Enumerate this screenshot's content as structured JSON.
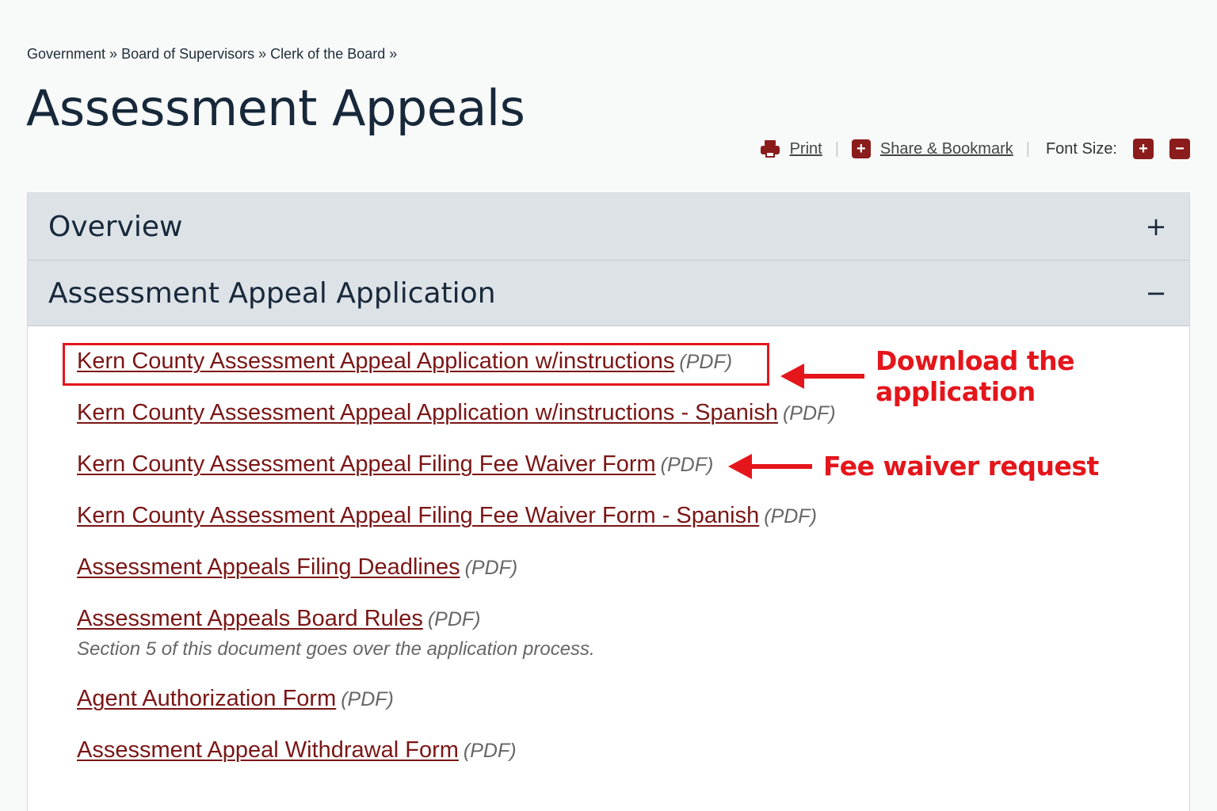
{
  "breadcrumb": {
    "items": [
      "Government",
      "Board of Supervisors",
      "Clerk of the Board"
    ],
    "separator": "»"
  },
  "page_title": "Assessment Appeals",
  "tools": {
    "print_label": "Print",
    "share_label": "Share & Bookmark",
    "font_size_label": "Font Size:",
    "increase_symbol": "+",
    "decrease_symbol": "−"
  },
  "accordion": {
    "sections": [
      {
        "title": "Overview",
        "toggle": "+",
        "expanded": false
      },
      {
        "title": "Assessment Appeal Application",
        "toggle": "−",
        "expanded": true
      }
    ]
  },
  "documents": [
    {
      "link": "Kern County Assessment Appeal Application w/instructions",
      "type": "(PDF)"
    },
    {
      "link": "Kern County Assessment Appeal Application w/instructions - Spanish",
      "type": "(PDF)"
    },
    {
      "link": "Kern County Assessment Appeal Filing Fee Waiver Form",
      "type": "(PDF)"
    },
    {
      "link": "Kern County Assessment Appeal Filing Fee Waiver Form - Spanish",
      "type": "(PDF)"
    },
    {
      "link": "Assessment Appeals Filing Deadlines",
      "type": "(PDF)"
    },
    {
      "link": "Assessment Appeals Board Rules",
      "type": "(PDF)",
      "note": "Section 5 of this document goes over the application process."
    },
    {
      "link": "Agent Authorization Form",
      "type": "(PDF)"
    },
    {
      "link": "Assessment Appeal Withdrawal Form",
      "type": "(PDF)"
    }
  ],
  "annotations": {
    "download": "Download the application",
    "fee_waiver": "Fee waiver request",
    "color": "#e4151b"
  },
  "colors": {
    "link": "#7b1616",
    "accent_icon": "#8b1c1c",
    "accordion_header": "#dde2e7",
    "title": "#17283a"
  }
}
